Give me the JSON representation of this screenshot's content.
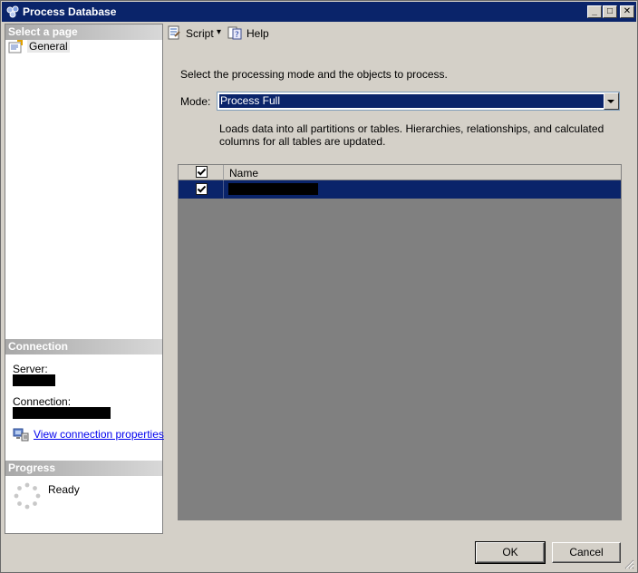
{
  "window": {
    "title": "Process Database",
    "minimize_glyph": "_",
    "maximize_glyph": "□",
    "close_glyph": "✕"
  },
  "left_pane": {
    "select_page_header": "Select a page",
    "pages": [
      {
        "label": "General",
        "icon": "page-icon"
      }
    ],
    "connection_header": "Connection",
    "server_label": "Server:",
    "connection_label": "Connection:",
    "view_connection_properties": "View connection properties",
    "progress_header": "Progress",
    "progress_status": "Ready"
  },
  "toolbar": {
    "script_label": "Script",
    "script_dropdown_glyph": "▾",
    "help_label": "Help"
  },
  "main": {
    "instruction": "Select the processing mode and the objects to process.",
    "mode_label": "Mode:",
    "mode_value": "Process Full",
    "mode_description": "Loads data into all partitions or tables. Hierarchies, relationships, and calculated columns for all tables are updated.",
    "grid": {
      "columns": [
        "",
        "Name"
      ],
      "header_checked": true,
      "rows": [
        {
          "checked": true,
          "name_redacted": true,
          "selected": true
        }
      ]
    }
  },
  "buttons": {
    "ok": "OK",
    "cancel": "Cancel"
  },
  "colors": {
    "titlebar": "#0a246a",
    "selection": "#0a246a",
    "window_bg": "#d4d0c8",
    "grid_bg": "#808080",
    "link": "#0000ee"
  }
}
